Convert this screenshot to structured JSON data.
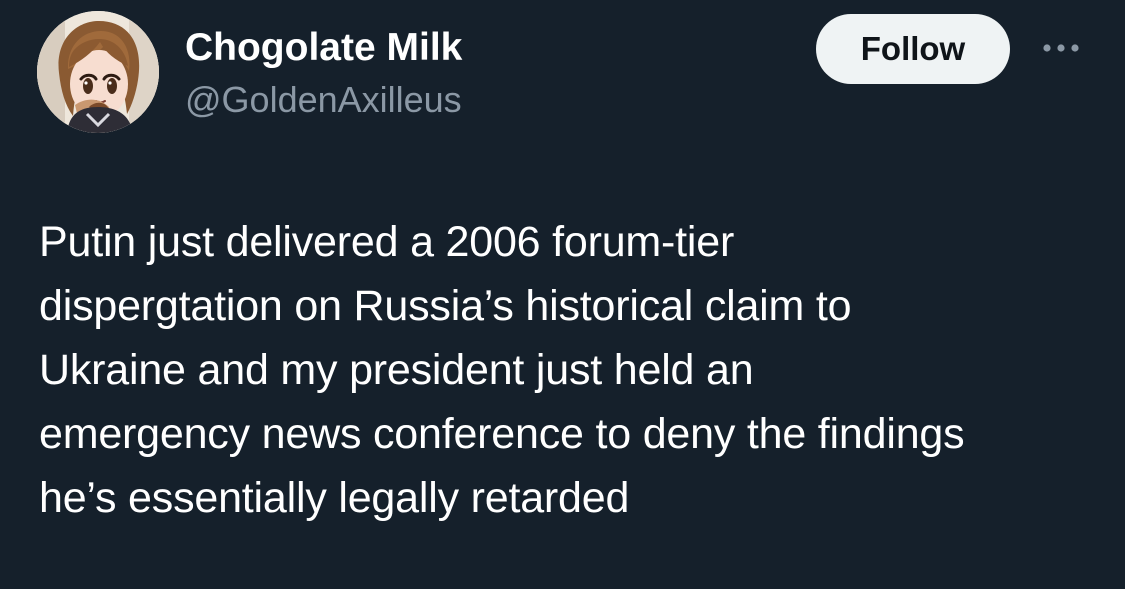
{
  "tweet": {
    "author": {
      "display_name": "Chogolate Milk",
      "handle": "@GoldenAxilleus",
      "avatar_icon": "anime-girl-avatar"
    },
    "follow_label": "Follow",
    "more_icon": "more-horizontal-icon",
    "text": "Putin just delivered a 2006 forum-tier\ndispergtation on Russia’s historical claim to\nUkraine and my president just held an\nemergency news conference to deny the findings\nhe’s essentially legally retarded"
  },
  "colors": {
    "background": "#15202b",
    "primary_text": "#ffffff",
    "secondary_text": "#8b98a5",
    "follow_background": "#eff3f4",
    "follow_text": "#0f1419"
  }
}
